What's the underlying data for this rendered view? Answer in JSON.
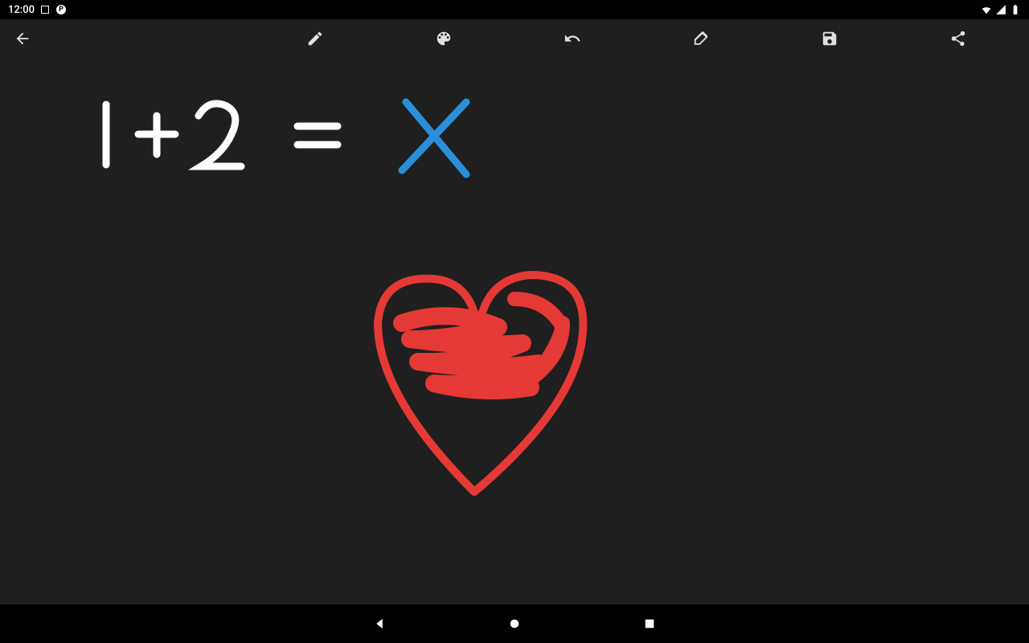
{
  "status_bar": {
    "time": "12:00",
    "icons_left": [
      "square-indicator",
      "p-badge"
    ],
    "icons_right": [
      "wifi-icon",
      "signal-icon",
      "battery-icon"
    ]
  },
  "toolbar": {
    "back": "back-icon",
    "actions": [
      {
        "name": "pencil-icon",
        "label": "Draw"
      },
      {
        "name": "palette-icon",
        "label": "Color"
      },
      {
        "name": "undo-icon",
        "label": "Undo"
      },
      {
        "name": "eraser-icon",
        "label": "Eraser"
      },
      {
        "name": "save-icon",
        "label": "Save"
      },
      {
        "name": "share-icon",
        "label": "Share"
      }
    ]
  },
  "canvas": {
    "strokes": [
      {
        "label": "equation-text",
        "content": "1 + 2 = X",
        "parts": [
          {
            "text": "1 + 2 =",
            "color": "#ffffff"
          },
          {
            "text": "X",
            "color": "#2a8fd8"
          }
        ]
      },
      {
        "label": "heart-drawing",
        "color": "#e53935"
      }
    ]
  },
  "nav_bar": {
    "buttons": [
      "nav-back-icon",
      "nav-home-icon",
      "nav-recent-icon"
    ]
  },
  "colors": {
    "background": "#1f1f1f",
    "stroke_white": "#ffffff",
    "stroke_blue": "#2a8fd8",
    "stroke_red": "#e53935"
  }
}
